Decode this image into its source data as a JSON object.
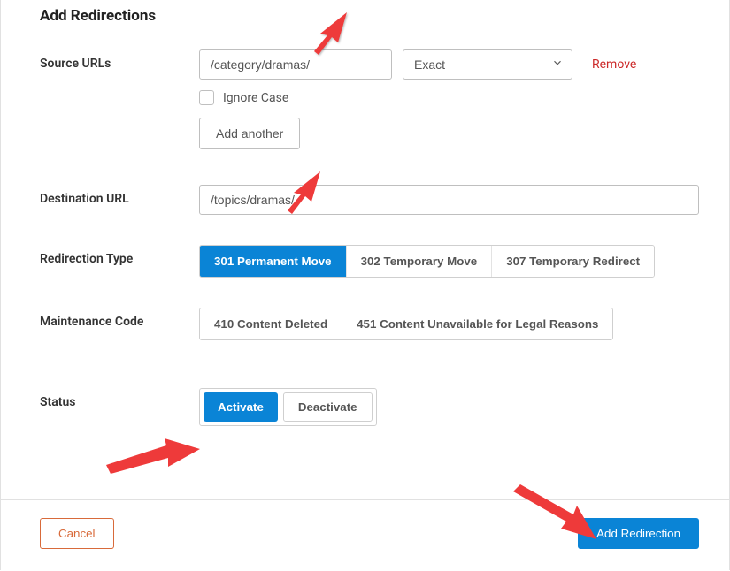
{
  "title": "Add Redirections",
  "source": {
    "label": "Source URLs",
    "url_value": "/category/dramas/",
    "match_type": "Exact",
    "remove": "Remove",
    "ignore_case": "Ignore Case",
    "add_another": "Add another"
  },
  "destination": {
    "label": "Destination URL",
    "value": "/topics/dramas/"
  },
  "redirection_type": {
    "label": "Redirection Type",
    "options": [
      "301 Permanent Move",
      "302 Temporary Move",
      "307 Temporary Redirect"
    ],
    "active": 0
  },
  "maintenance": {
    "label": "Maintenance Code",
    "options": [
      "410 Content Deleted",
      "451 Content Unavailable for Legal Reasons"
    ],
    "active": -1
  },
  "status": {
    "label": "Status",
    "options": [
      "Activate",
      "Deactivate"
    ],
    "active": 0
  },
  "footer": {
    "cancel": "Cancel",
    "submit": "Add Redirection"
  }
}
